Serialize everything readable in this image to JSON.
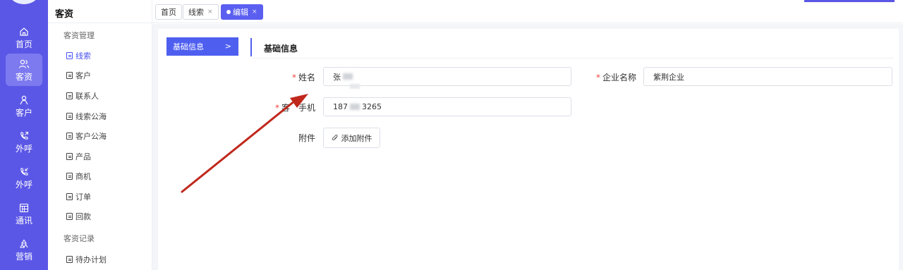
{
  "rail": {
    "items": [
      {
        "label": "首页",
        "icon": "home-icon"
      },
      {
        "label": "客资",
        "icon": "users-icon",
        "active": true
      },
      {
        "label": "客户",
        "icon": "person-icon"
      },
      {
        "label": "外呼",
        "icon": "phone-outgoing-icon"
      },
      {
        "label": "外呼",
        "icon": "phone-callback-icon"
      },
      {
        "label": "通讯",
        "icon": "calendar-grid-icon"
      },
      {
        "label": "营销",
        "icon": "recycle-icon"
      }
    ]
  },
  "menu": {
    "title": "客资",
    "groups": [
      {
        "label": "客资管理",
        "items": [
          "线索",
          "客户",
          "联系人",
          "线索公海",
          "客户公海",
          "产品",
          "商机",
          "订单",
          "回款"
        ]
      },
      {
        "label": "客资记录",
        "items": [
          "待办计划"
        ]
      }
    ],
    "active_item": "线索"
  },
  "tabs": [
    {
      "label": "首页",
      "closable": false,
      "active": false
    },
    {
      "label": "线索",
      "closable": true,
      "active": false
    },
    {
      "label": "编辑",
      "closable": true,
      "active": true
    }
  ],
  "tab_close_glyph": "×",
  "form": {
    "side_tab_label": "基础信息",
    "side_tab_chevron": ">",
    "section_title": "基础信息",
    "required_mark": "*",
    "fields": {
      "name": {
        "label": "姓名",
        "value_prefix": "张",
        "required": true
      },
      "company": {
        "label": "企业名称",
        "value": "紫荆企业",
        "required": true
      },
      "phone": {
        "label_start": "客",
        "label_end": "手机",
        "value_prefix": "187",
        "value_suffix": "3265",
        "required": true
      },
      "attachment": {
        "label": "附件",
        "button_label": "添加附件"
      }
    }
  },
  "colors": {
    "rail_bg": "#5b57e6",
    "accent": "#4e5ff0",
    "required": "#f04848",
    "annotation_arrow": "#c0281c"
  }
}
